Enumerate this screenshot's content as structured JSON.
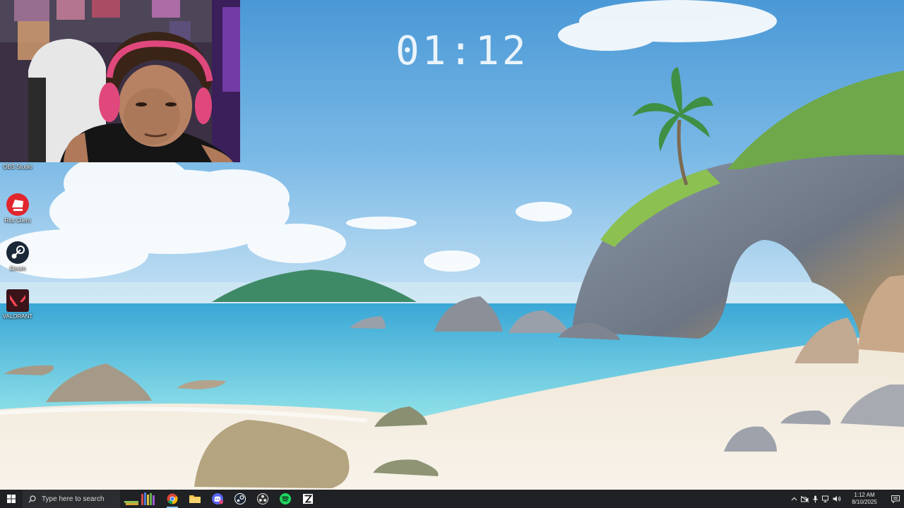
{
  "desktop": {
    "clock_overlay": "01:12",
    "icons": [
      {
        "label": "OBS Studio",
        "icon": "obs-icon"
      },
      {
        "label": "Riot Client",
        "icon": "riot-client-icon"
      },
      {
        "label": "Steam",
        "icon": "steam-icon"
      },
      {
        "label": "VALORANT",
        "icon": "valorant-icon"
      }
    ]
  },
  "taskbar": {
    "search_placeholder": "Type here to search",
    "apps": [
      {
        "name": "widgets",
        "icon": "books-widget-icon"
      },
      {
        "name": "chrome",
        "icon": "chrome-icon",
        "active": true
      },
      {
        "name": "file-explorer",
        "icon": "folder-icon"
      },
      {
        "name": "discord",
        "icon": "discord-icon"
      },
      {
        "name": "steam",
        "icon": "steam-icon"
      },
      {
        "name": "obs",
        "icon": "obs-icon"
      },
      {
        "name": "spotify",
        "icon": "spotify-icon"
      },
      {
        "name": "epic-games",
        "icon": "epic-games-icon"
      }
    ],
    "tray": {
      "time": "1:12 AM",
      "date": "8/10/2025"
    }
  },
  "colors": {
    "taskbar_bg": "#1f2124",
    "active_indicator": "#8ec3f5",
    "sky": "#5aa3d8",
    "sea": "#4ec0d8",
    "sand": "#f3ecdf"
  }
}
